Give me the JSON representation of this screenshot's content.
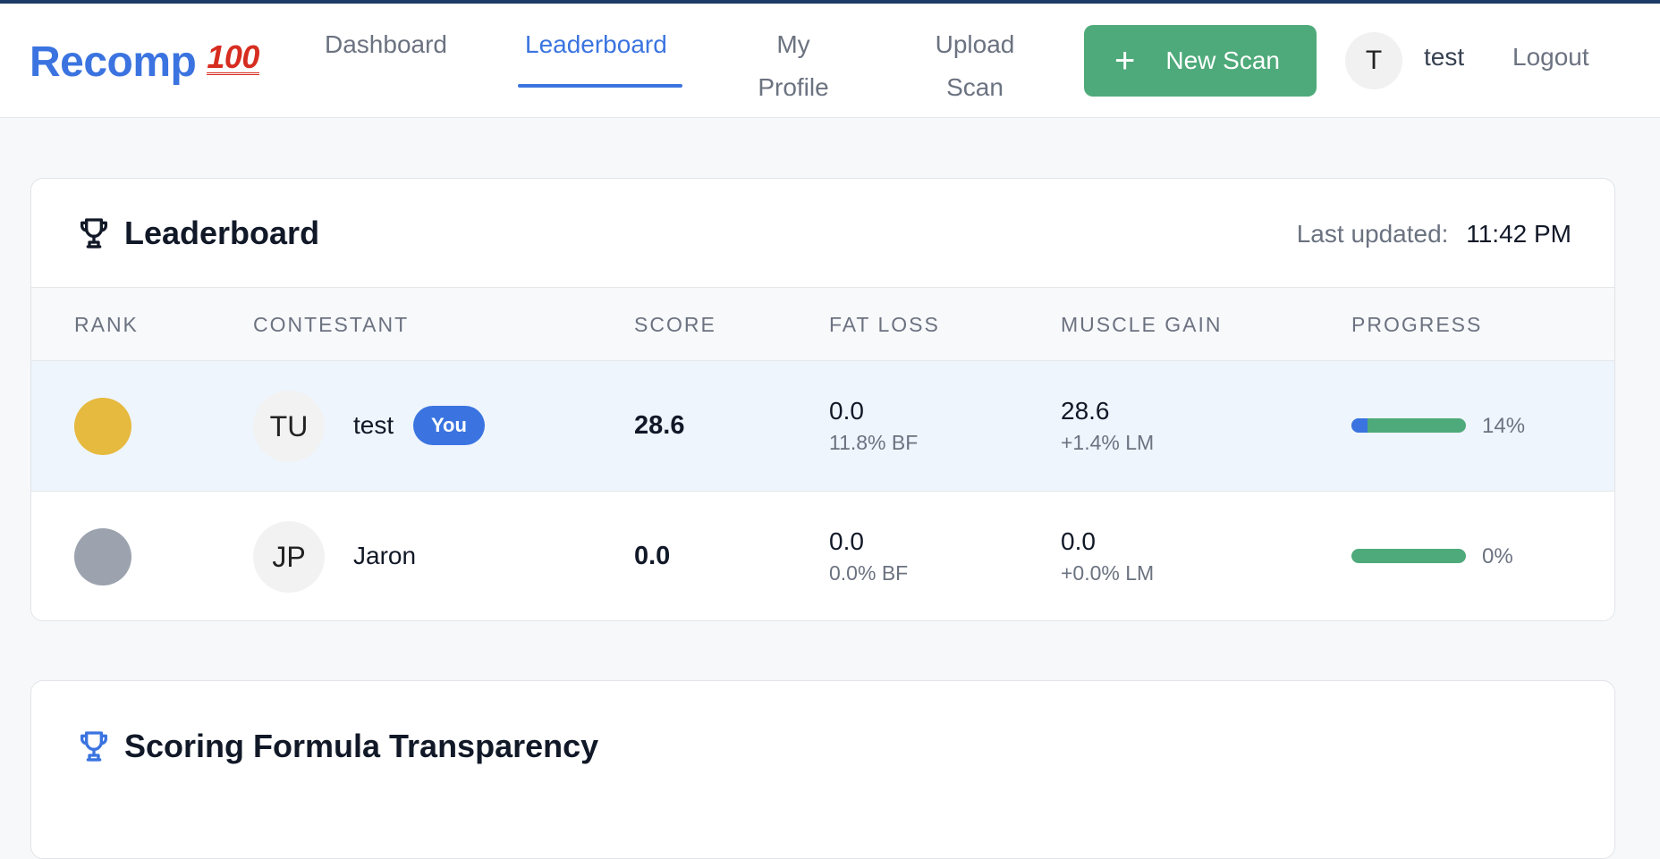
{
  "nav": {
    "brand": "Recomp",
    "brand_emoji": "100",
    "links": [
      "Dashboard",
      "Leaderboard",
      "My Profile",
      "Upload Scan"
    ],
    "active": "Leaderboard",
    "new_scan_label": "New Scan",
    "user_initial": "T",
    "username": "test",
    "logout": "Logout",
    "accent": "#3b74e0",
    "new_scan_color": "#4eaa7a"
  },
  "leaderboard": {
    "title": "Leaderboard",
    "last_updated_label": "Last updated:",
    "last_updated_time": "11:42 PM",
    "columns": [
      "RANK",
      "CONTESTANT",
      "SCORE",
      "FAT LOSS",
      "MUSCLE GAIN",
      "PROGRESS"
    ],
    "rows": [
      {
        "medal_color": "#e6b93f",
        "initials": "TU",
        "name": "test",
        "badge": "You",
        "score": "28.6",
        "fat_loss": "0.0",
        "fat_loss_sub": "11.8% BF",
        "muscle_gain": "28.6",
        "muscle_gain_sub": "+1.4% LM",
        "progress_pct": "14%",
        "progress_fraction": 0.14
      },
      {
        "medal_color": "#9ca3af",
        "initials": "JP",
        "name": "Jaron",
        "badge": "",
        "score": "0.0",
        "fat_loss": "0.0",
        "fat_loss_sub": "0.0% BF",
        "muscle_gain": "0.0",
        "muscle_gain_sub": "+0.0% LM",
        "progress_pct": "0%",
        "progress_fraction": 0
      }
    ]
  },
  "scoring": {
    "title": "Scoring Formula Transparency"
  }
}
